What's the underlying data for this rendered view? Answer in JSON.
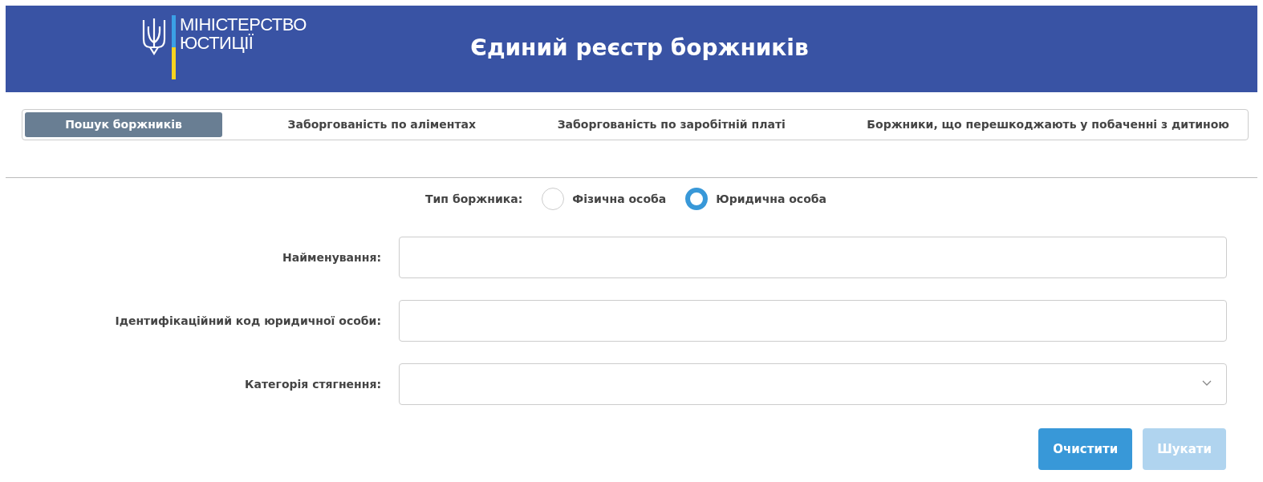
{
  "header": {
    "logo_lines": [
      "МІНІСТЕРСТВО",
      "ЮСТИЦІЇ"
    ],
    "title": "Єдиний реєстр боржників"
  },
  "tabs": [
    {
      "label": "Пошук боржників",
      "selected": true
    },
    {
      "label": "Заборгованість по аліментах",
      "selected": false
    },
    {
      "label": "Заборгованість по заробітній платі",
      "selected": false
    },
    {
      "label": "Боржники, що перешкоджають у побаченні з дитиною",
      "selected": false
    }
  ],
  "debtor_type": {
    "label": "Тип боржника:",
    "options": [
      {
        "label": "Фізична особа",
        "selected": false
      },
      {
        "label": "Юридична особа",
        "selected": true
      }
    ]
  },
  "fields": [
    {
      "label": "Найменування:",
      "kind": "text"
    },
    {
      "label": "Ідентифікаційний код юридичної особи:",
      "kind": "text"
    },
    {
      "label": "Категорія стягнення:",
      "kind": "select"
    }
  ],
  "buttons": [
    {
      "label": "Очистити",
      "disabled": false
    },
    {
      "label": "Шукати",
      "disabled": true
    }
  ]
}
